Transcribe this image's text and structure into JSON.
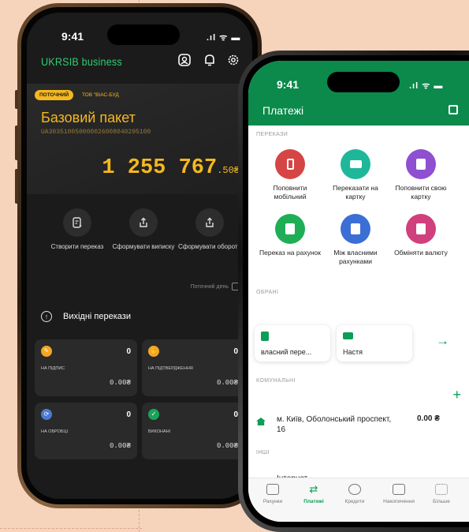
{
  "phone1": {
    "status": {
      "time": "9:41",
      "signal": ".ıl ᯤ ▬"
    },
    "header": {
      "brand": "UKRSIB business",
      "icons": [
        "support-icon",
        "bell-icon",
        "gear-icon"
      ]
    },
    "account": {
      "pill": "ПОТОЧНИЙ",
      "company": "ТОВ \"ВІАС-БУД",
      "name": "Базовий пакет",
      "iban": "UA303510050000026008040295100",
      "balance_int": "1 255 767",
      "balance_dec": ".50₴"
    },
    "actions": [
      {
        "label": "Створити переказ",
        "icon": "create-transfer-icon"
      },
      {
        "label": "Сформувати виписку",
        "icon": "share-icon"
      },
      {
        "label": "Сформувати обороти",
        "icon": "share-icon"
      }
    ],
    "date_label": "Поточний день",
    "outgoing": {
      "label": "Вихідні перекази",
      "chevron": "›"
    },
    "cards": [
      {
        "label": "НА ПІДПИС",
        "count": "0",
        "amount": "0.00₴",
        "color": "#f5a623"
      },
      {
        "label": "НА ПІДТВЕРДЖЕННЯ",
        "count": "0",
        "amount": "0.00₴",
        "color": "#f5a623"
      },
      {
        "label": "НА ОБРОБЦІ",
        "count": "0",
        "amount": "0.00₴",
        "color": "#4a7bd0"
      },
      {
        "label": "ВИКОНАНІ",
        "count": "0",
        "amount": "0.00₴",
        "color": "#1aa35a"
      }
    ]
  },
  "phone2": {
    "status": {
      "time": "9:41",
      "signal": ".ıl ᯤ ▬"
    },
    "title": "Платежі",
    "sections": {
      "transfers": "ПЕРЕКАЗИ",
      "favorites": "ОБРАНІ",
      "utilities": "КОМУНАЛЬНІ",
      "other": "ІНШІ"
    },
    "tiles": [
      {
        "label": "Поповнити мобільний",
        "color": "#d64545"
      },
      {
        "label": "Переказати на картку",
        "color": "#1fb79a"
      },
      {
        "label": "Поповнити свою картку",
        "color": "#8e4fd1"
      },
      {
        "label": "Переказ на рахунок",
        "color": "#1fae55"
      },
      {
        "label": "Між власними рахунками",
        "color": "#3b6fd6"
      },
      {
        "label": "Обміняти валюту",
        "color": "#d0407c"
      }
    ],
    "favorites": [
      "власний пере...",
      "Настя"
    ],
    "utility": {
      "address": "м. Київ, Оболонський проспект, 16",
      "amount": "0.00 ₴"
    },
    "other_item": "Інтернет",
    "tabs": [
      {
        "label": "Рахунки",
        "active": false
      },
      {
        "label": "Платежі",
        "active": true
      },
      {
        "label": "Кредити",
        "active": false
      },
      {
        "label": "Накопичення",
        "active": false
      },
      {
        "label": "Більше",
        "active": false
      }
    ],
    "accent": "#0b9e56"
  }
}
